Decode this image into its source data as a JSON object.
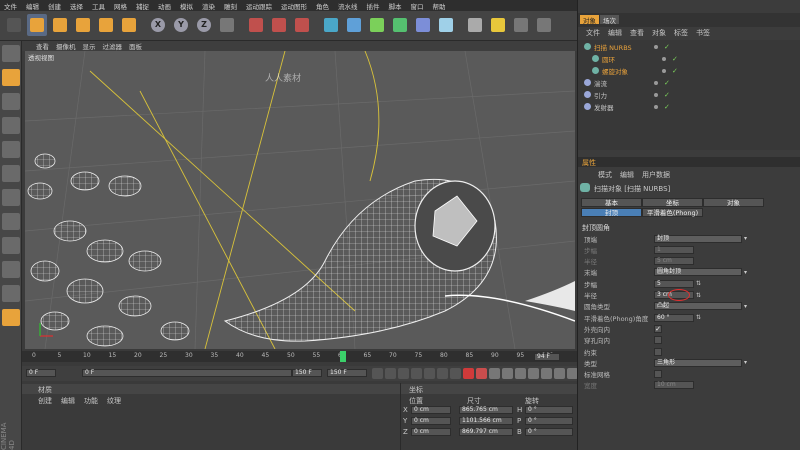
{
  "menu": [
    "文件",
    "编辑",
    "创建",
    "选择",
    "工具",
    "网格",
    "捕捉",
    "动画",
    "模拟",
    "渲染",
    "雕刻",
    "运动跟踪",
    "运动图形",
    "角色",
    "流水线",
    "插件",
    "脚本",
    "窗口",
    "帮助"
  ],
  "toolbar": {
    "icons": [
      "undo-icon",
      "select-icon",
      "move-icon",
      "scale-icon",
      "rotate-icon",
      "add-icon",
      "x-axis-icon",
      "y-axis-icon",
      "z-axis-icon",
      "world-coord-icon",
      "render-view-icon",
      "render-icon",
      "render-settings-icon",
      "cube-icon",
      "spline-pen-icon",
      "subdivision-icon",
      "array-icon",
      "deformer-icon",
      "scene-icon",
      "camera-icon",
      "light-icon",
      "layout-icon",
      "grid-icon"
    ],
    "axis_labels": [
      "X",
      "Y",
      "Z"
    ]
  },
  "viewport": {
    "menu": [
      "查看",
      "摄像机",
      "显示",
      "过滤器",
      "面板"
    ],
    "label": "透视视图",
    "watermark": "人人素材"
  },
  "timeline": {
    "ticks": [
      "0",
      "5",
      "10",
      "15",
      "20",
      "25",
      "30",
      "35",
      "40",
      "45",
      "50",
      "55",
      "60",
      "65",
      "70",
      "75",
      "80",
      "85",
      "90",
      "95",
      "100"
    ],
    "current_frame": "94 F",
    "end_frame": "0 F",
    "start_field": "0 F",
    "start_field2": "0 F",
    "end_field": "150 F",
    "end_field2": "150 F"
  },
  "materials": {
    "title": "材质",
    "menu": [
      "创建",
      "编辑",
      "功能",
      "纹理"
    ]
  },
  "coords": {
    "title": "坐标",
    "headers": [
      "位置",
      "尺寸",
      "旋转"
    ],
    "rows": [
      {
        "axis": "X",
        "pos": "0 cm",
        "size": "865.765 cm",
        "rot_label": "H",
        "rot": "0 °"
      },
      {
        "axis": "Y",
        "pos": "0 cm",
        "size": "1101.566 cm",
        "rot_label": "P",
        "rot": "0 °"
      },
      {
        "axis": "Z",
        "pos": "0 cm",
        "size": "869.797 cm",
        "rot_label": "B",
        "rot": "0 °"
      }
    ],
    "brand": "CINEMA 4D"
  },
  "objects": {
    "tabs": [
      "对象",
      "场次"
    ],
    "menu": [
      "文件",
      "编辑",
      "查看",
      "对象",
      "标签",
      "书签"
    ],
    "items": [
      {
        "name": "扫描 NURBS",
        "indent": 0,
        "color": "#e9a23b"
      },
      {
        "name": "圆环",
        "indent": 1,
        "color": "#e9a23b"
      },
      {
        "name": "螺旋对象",
        "indent": 1,
        "color": "#e9a23b"
      },
      {
        "name": "湍流",
        "indent": 0,
        "color": "#c8c8c8"
      },
      {
        "name": "引力",
        "indent": 0,
        "color": "#c8c8c8"
      },
      {
        "name": "发射器",
        "indent": 0,
        "color": "#c8c8c8"
      }
    ]
  },
  "attributes": {
    "title": "属性",
    "menu": [
      "模式",
      "编辑",
      "用户数据"
    ],
    "object_title": "扫描对象 [扫描 NURBS]",
    "tabs": [
      "基本",
      "坐标",
      "对象",
      "封顶",
      "平滑着色(Phong)"
    ],
    "section": "封顶圆角",
    "fields": [
      {
        "label": "顶端",
        "value": "封顶",
        "type": "dropdown"
      },
      {
        "label": "步幅",
        "value": "1",
        "type": "disabled"
      },
      {
        "label": "半径",
        "value": "5 cm",
        "type": "disabled"
      },
      {
        "label": "末端",
        "value": "圆角封顶",
        "type": "dropdown"
      },
      {
        "label": "步幅",
        "value": "5",
        "type": "field"
      },
      {
        "label": "半径",
        "value": "3 cm",
        "type": "field"
      },
      {
        "label": "圆角类型",
        "value": "凸起",
        "type": "dropdown"
      },
      {
        "label": "平滑着色(Phong)角度",
        "value": "60 °",
        "type": "field"
      },
      {
        "label": "外壳向内",
        "value": "✓",
        "type": "check"
      },
      {
        "label": "穿孔向内",
        "value": "",
        "type": "check"
      },
      {
        "label": "约束",
        "value": "",
        "type": "check"
      },
      {
        "label": "类型",
        "value": "三角形",
        "type": "dropdown"
      },
      {
        "label": "标准网格",
        "value": "",
        "type": "check"
      },
      {
        "label": "宽度",
        "value": "10 cm",
        "type": "disabled"
      }
    ]
  },
  "colors": {
    "accent": "#e8a33b",
    "highlight": "#4a7fb6",
    "red_mark": "#e03030"
  }
}
